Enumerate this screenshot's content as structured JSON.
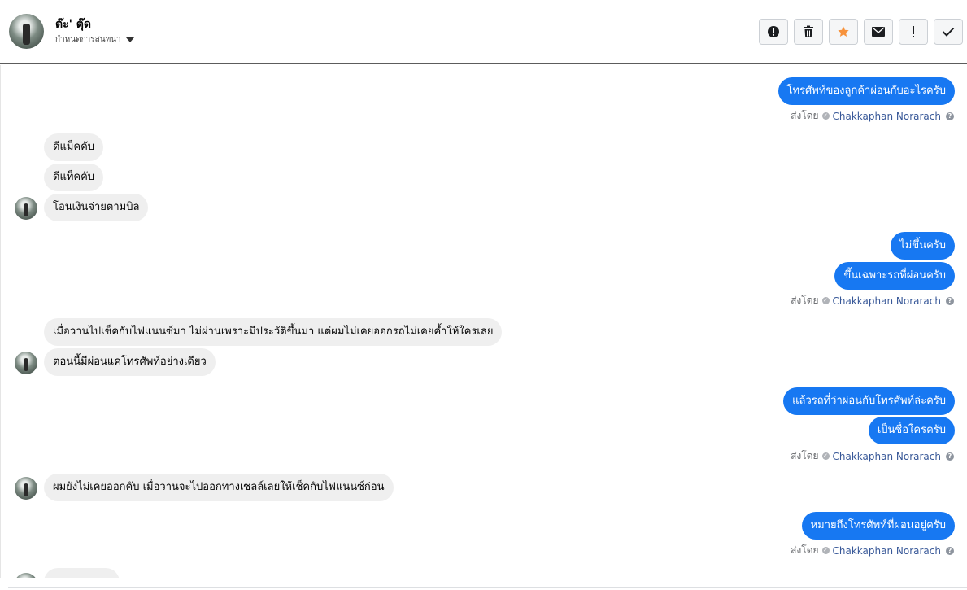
{
  "header": {
    "name": "ต๊ะ' ตุ๊ด",
    "subtitle": "กำหนดการสนทนา",
    "actions": [
      {
        "icon": "alert-circle-icon",
        "label": "Report"
      },
      {
        "icon": "trash-icon",
        "label": "Delete"
      },
      {
        "icon": "star-icon",
        "label": "Star",
        "color": "#f7923b"
      },
      {
        "icon": "envelope-icon",
        "label": "Mark unread"
      },
      {
        "icon": "exclamation-icon",
        "label": "Spam"
      },
      {
        "icon": "check-icon",
        "label": "Done"
      }
    ]
  },
  "messages": {
    "m1": "โทรศัพท์ของลูกค้าผ่อนกับอะไรครับ",
    "m2": "ดีแม็คคับ",
    "m3": "ดีแท็คคับ",
    "m4": "โอนเงินจ่ายตามบิล",
    "m5": "ไม่ขึ้นครับ",
    "m6": "ขึ้นเฉพาะรถที่ผ่อนครับ",
    "m7": "เมื่อวานไปเช็คกับไฟแนนซ์มา ไม่ผ่านเพราะมีประวัติขึ้นมา  แต่ผมไม่เคยออกรถไม่เคยค้ำให้ใครเลย",
    "m8": "ตอนนี้มีผ่อนแค่โทรศัพท์อย่างเดียว",
    "m9": "แล้วรถที่ว่าผ่อนกับโทรศัพท์ล่ะครับ",
    "m10": "เป็นชื่อใครครับ",
    "m11": "ผมยังไม่เคยออกคับ  เมื่อวานจะไปออกทางเซลล์เลยให้เช็คกับไฟแนนซ์ก่อน",
    "m12": "หมายถึงโทรศัพท์ที่ผ่อนอยู่ครับ"
  },
  "sent_by": {
    "prefix": "ส่งโดย",
    "agent": "Chakkaphan Norarach"
  },
  "colors": {
    "outgoing_bubble": "#1778f2",
    "incoming_bubble": "#efefef",
    "agent_link": "#385898"
  }
}
